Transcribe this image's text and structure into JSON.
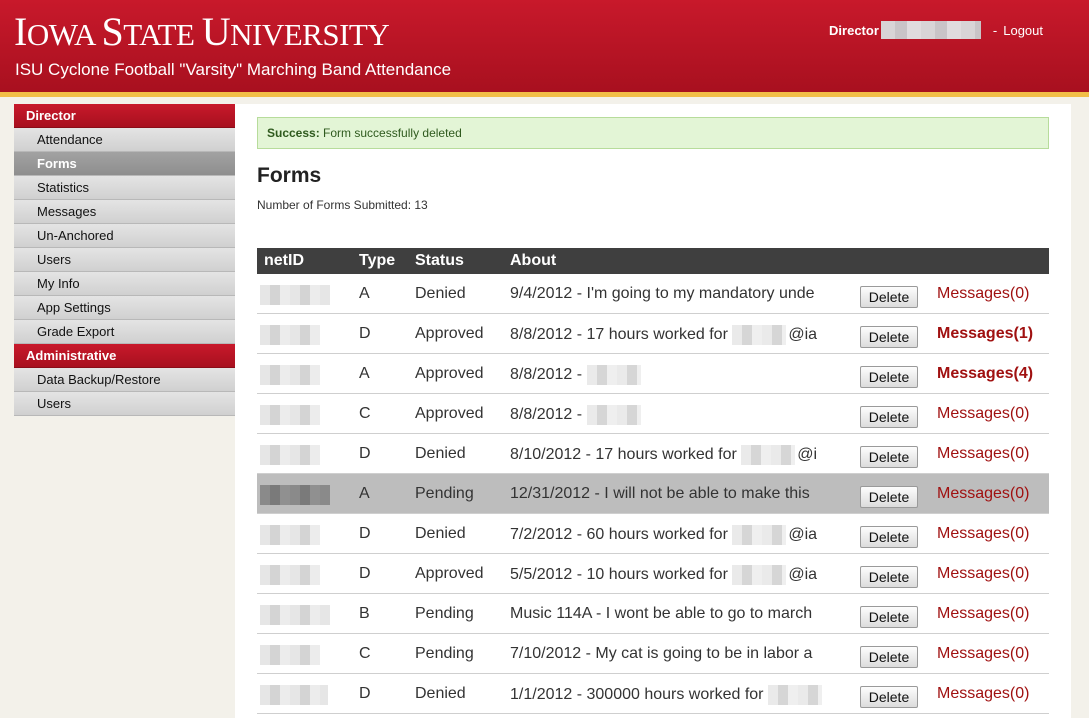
{
  "header": {
    "brand_prefix_1": "I",
    "brand_rest_1": "OWA ",
    "brand_prefix_2": "S",
    "brand_rest_2": "TATE ",
    "brand_prefix_3": "U",
    "brand_rest_3": "NIVERSITY",
    "subtitle": "ISU Cyclone Football \"Varsity\" Marching Band Attendance",
    "user_role": "Director",
    "separator": "-",
    "logout": "Logout"
  },
  "sidebar": {
    "section1": "Director",
    "items1": [
      "Attendance",
      "Forms",
      "Statistics",
      "Messages",
      "Un-Anchored",
      "Users",
      "My Info",
      "App Settings",
      "Grade Export"
    ],
    "active": "Forms",
    "section2": "Administrative",
    "items2": [
      "Data Backup/Restore",
      "Users"
    ]
  },
  "alert": {
    "label": "Success:",
    "text": "Form successfully deleted"
  },
  "page": {
    "title": "Forms",
    "count_label": "Number of Forms Submitted: 13"
  },
  "table": {
    "headers": {
      "netid": "netID",
      "type": "Type",
      "status": "Status",
      "about": "About"
    },
    "delete_label": "Delete",
    "rows": [
      {
        "type": "A",
        "status": "Denied",
        "about": "9/4/2012 - I'm going to my mandatory unde",
        "about_suffix": "",
        "messages": "Messages(0)",
        "bold": false
      },
      {
        "type": "D",
        "status": "Approved",
        "about": "8/8/2012 - 17 hours worked for ",
        "about_suffix": "@ia",
        "messages": "Messages(1)",
        "bold": true
      },
      {
        "type": "A",
        "status": "Approved",
        "about": "8/8/2012 - ",
        "about_suffix": "",
        "messages": "Messages(4)",
        "bold": true
      },
      {
        "type": "C",
        "status": "Approved",
        "about": "8/8/2012 - ",
        "about_suffix": "",
        "messages": "Messages(0)",
        "bold": false
      },
      {
        "type": "D",
        "status": "Denied",
        "about": "8/10/2012 - 17 hours worked for ",
        "about_suffix": "@i",
        "messages": "Messages(0)",
        "bold": false
      },
      {
        "type": "A",
        "status": "Pending",
        "about": "12/31/2012 - I will not be able to make this",
        "about_suffix": "",
        "messages": "Messages(0)",
        "bold": false
      },
      {
        "type": "D",
        "status": "Denied",
        "about": "7/2/2012 - 60 hours worked for ",
        "about_suffix": "@ia",
        "messages": "Messages(0)",
        "bold": false
      },
      {
        "type": "D",
        "status": "Approved",
        "about": "5/5/2012 - 10 hours worked for ",
        "about_suffix": "@ia",
        "messages": "Messages(0)",
        "bold": false
      },
      {
        "type": "B",
        "status": "Pending",
        "about": "Music 114A - I wont be able to go to march",
        "about_suffix": "",
        "messages": "Messages(0)",
        "bold": false
      },
      {
        "type": "C",
        "status": "Pending",
        "about": "7/10/2012 - My cat is going to be in labor a",
        "about_suffix": "",
        "messages": "Messages(0)",
        "bold": false
      },
      {
        "type": "D",
        "status": "Denied",
        "about": "1/1/2012 - 300000 hours worked for ",
        "about_suffix": "",
        "messages": "Messages(0)",
        "bold": false
      }
    ]
  },
  "colors": {
    "brand_red": "#c8192b",
    "gold": "#f1be48",
    "link_red": "#a01010",
    "success_bg": "#e3f5d6"
  }
}
